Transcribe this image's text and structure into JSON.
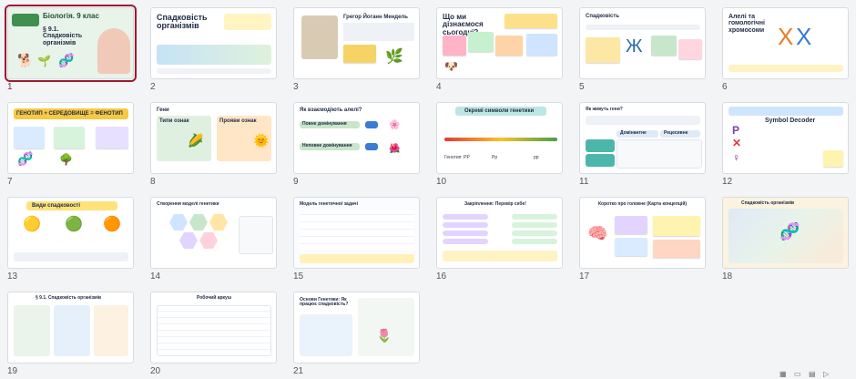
{
  "slides": [
    {
      "n": "1",
      "title": "Біологія. 9 клас",
      "subtitle": "§ 9.1. Спадковість організмів"
    },
    {
      "n": "2",
      "title": "Спадковість організмів"
    },
    {
      "n": "3",
      "title": "Грегор Йоганн Мендель"
    },
    {
      "n": "4",
      "title": "Що ми дізнаємося сьогодні?"
    },
    {
      "n": "5",
      "title": "Спадковість"
    },
    {
      "n": "6",
      "title": "Алелі та гомологічні хромосоми"
    },
    {
      "n": "7",
      "title": "ГЕНОТИП + СЕРЕДОВИЩЕ = ФЕНОТИП"
    },
    {
      "n": "8",
      "title": "Гени",
      "col1": "Типи ознак",
      "col2": "Прояви ознак"
    },
    {
      "n": "9",
      "title": "Як взаємодіють алелі?",
      "sub1": "Повне домінування",
      "sub2": "Неповне домінування"
    },
    {
      "n": "10",
      "title": "Окремі символи генетики",
      "labels": [
        "Генотип: PP",
        "Рр",
        "pp"
      ]
    },
    {
      "n": "11",
      "title": "Як живуть гени?",
      "h1": "Домінантне",
      "h2": "Рецесивне"
    },
    {
      "n": "12",
      "title": "Symbol Decoder"
    },
    {
      "n": "13",
      "title": "Види спадковості"
    },
    {
      "n": "14",
      "title": "Створення моделі генетики"
    },
    {
      "n": "15",
      "title": "Модель генетичної задачі"
    },
    {
      "n": "16",
      "title": "Закріплення: Перевір себе!"
    },
    {
      "n": "17",
      "title": "Коротко про головне (Карта концепцій)"
    },
    {
      "n": "18",
      "title": "Спадковість організмів"
    },
    {
      "n": "19",
      "title": "§ 9.1. Спадковість організмів"
    },
    {
      "n": "20",
      "title": "Робочий аркуш"
    },
    {
      "n": "21",
      "title": "Основи Генетики: Як працює спадковість?"
    }
  ],
  "colors": {
    "selected": "#9d1b2f",
    "accent_blue": "#2b6cb0",
    "accent_green": "#4caf50",
    "accent_yellow": "#f6c945"
  }
}
